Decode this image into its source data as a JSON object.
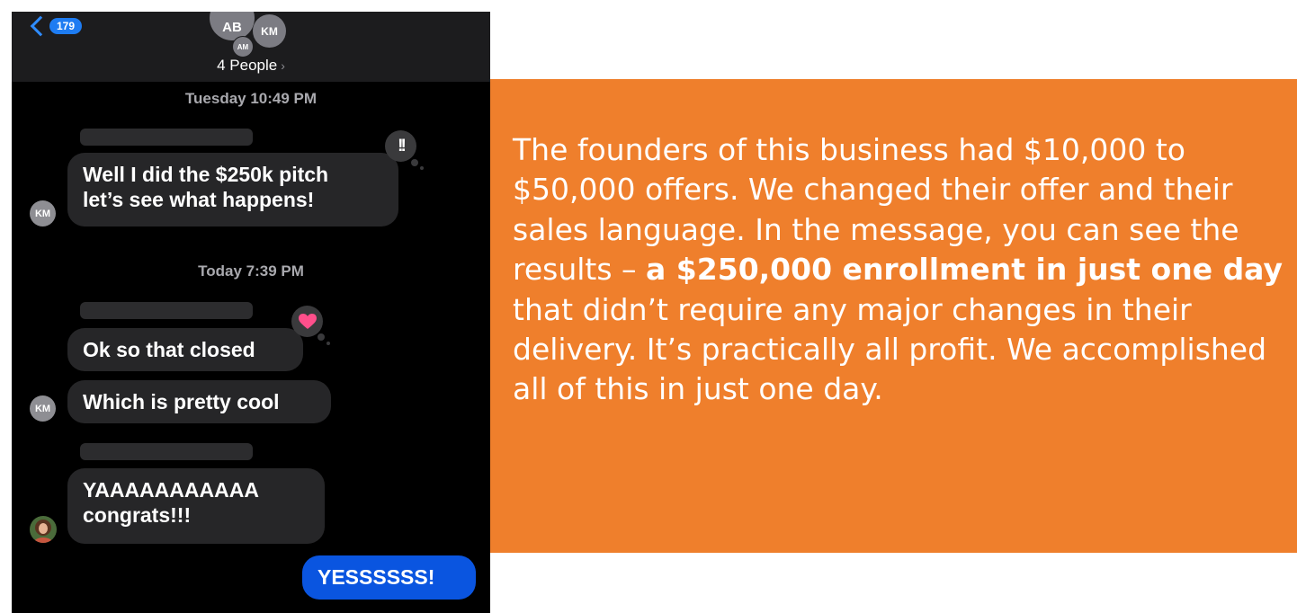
{
  "header": {
    "back_count": "179",
    "avatars": [
      "AB",
      "KM",
      "AM"
    ],
    "people_label": "4 People",
    "people_chevron": "›"
  },
  "conversation": {
    "timestamp_1": "Tuesday 10:49 PM",
    "timestamp_2": "Today 7:39 PM",
    "messages": [
      {
        "sender": "KM",
        "lines": [
          "Well I did the $250k pitch",
          "let’s see what happens!"
        ],
        "reaction": "!!"
      },
      {
        "sender": "KM",
        "lines": [
          "Ok so that closed"
        ],
        "reaction": "heart"
      },
      {
        "sender": "KM",
        "lines": [
          "Which is pretty cool"
        ]
      },
      {
        "sender": "photo",
        "lines": [
          "YAAAAAAAAAAA",
          "congrats!!!"
        ]
      },
      {
        "sender": "me",
        "lines": [
          "YESSSSSS!"
        ]
      }
    ],
    "avatar_label": "KM"
  },
  "callout": {
    "text_before": "The founders of this business had $10,000 to $50,000 offers. We changed their offer and their sales language. In the message, you can see the results – ",
    "text_bold": "a $250,000 enrollment in just one day",
    "text_after": " that didn’t require any major changes in their delivery. It’s practically all profit. We accomplished all of this in just one day."
  },
  "colors": {
    "callout_bg": "#ef7f2c",
    "sent_bubble": "#0a55e0",
    "received_bubble": "#262628",
    "heart": "#ff4f8b"
  }
}
